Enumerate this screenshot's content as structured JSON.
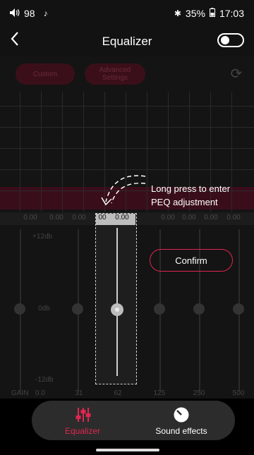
{
  "status": {
    "volume": "98",
    "battery": "35%",
    "time": "17:03"
  },
  "header": {
    "title": "Equalizer",
    "enabled": false
  },
  "toolbar": {
    "custom_label": "Custom",
    "advanced_label": "Advanced\nSettings"
  },
  "gain_values": [
    "0.00",
    "0.00",
    "0.00",
    "0.00",
    "0.00",
    "0.00",
    "0.00",
    "0.00",
    "0.00",
    "0.00"
  ],
  "gain_value_highlight": [
    "00",
    "0.00"
  ],
  "scale": {
    "top": "+12db",
    "mid": "0db",
    "bottom": "-12db",
    "gain_label": "GAIN",
    "gain_value": "0.0"
  },
  "frequencies": [
    "31",
    "62",
    "125",
    "250",
    "500"
  ],
  "hint": "Long press to enter PEQ adjustment",
  "confirm_label": "Confirm",
  "tabs": [
    {
      "label": "Equalizer",
      "active": true,
      "icon": "equalizer-icon"
    },
    {
      "label": "Sound effects",
      "active": false,
      "icon": "sound-effects-icon"
    }
  ],
  "colors": {
    "accent": "#e02650",
    "background": "#141414"
  }
}
